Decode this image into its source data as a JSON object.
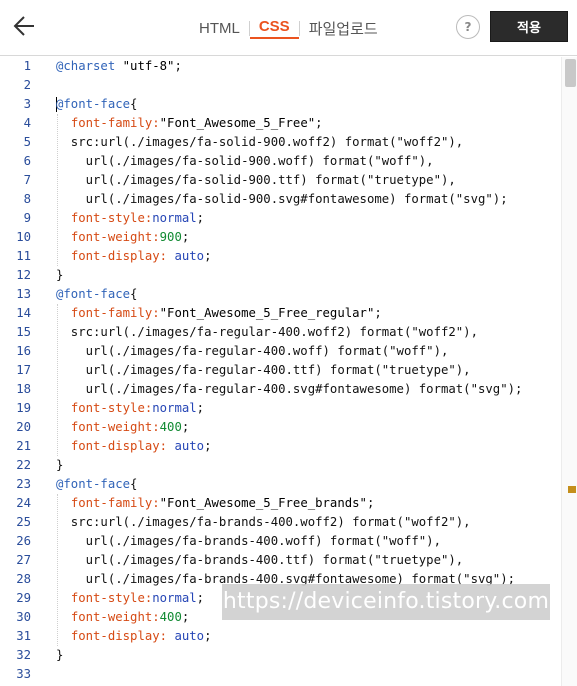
{
  "header": {
    "back_icon": "arrow-left-icon",
    "tabs": [
      {
        "label": "HTML",
        "active": false
      },
      {
        "label": "CSS",
        "active": true
      },
      {
        "label": "파일업로드",
        "active": false
      }
    ],
    "help_label": "?",
    "apply_label": "적용",
    "accent_color": "#eb531f"
  },
  "editor": {
    "line_numbers": [
      "1",
      "2",
      "3",
      "4",
      "5",
      "6",
      "7",
      "8",
      "9",
      "10",
      "11",
      "12",
      "13",
      "14",
      "15",
      "16",
      "17",
      "18",
      "19",
      "20",
      "21",
      "22",
      "23",
      "24",
      "25",
      "26",
      "27",
      "28",
      "29",
      "30",
      "31",
      "32",
      "33"
    ],
    "lines": [
      [
        {
          "t": "@charset ",
          "c": "at"
        },
        {
          "t": "\"utf-8\"",
          "c": "str"
        },
        {
          "t": ";",
          "c": "plain"
        }
      ],
      [],
      [
        {
          "t": "@font-face",
          "c": "at"
        },
        {
          "t": "{",
          "c": "plain"
        }
      ],
      [
        {
          "t": "  ",
          "c": "plain"
        },
        {
          "t": "font-family:",
          "c": "prop"
        },
        {
          "t": "\"Font_Awesome_5_Free\"",
          "c": "str"
        },
        {
          "t": ";",
          "c": "plain"
        }
      ],
      [
        {
          "t": "  src:url(./images/fa-solid-900.woff2) format(\"woff2\"),",
          "c": "plain"
        }
      ],
      [
        {
          "t": "    url(./images/fa-solid-900.woff) format(\"woff\"),",
          "c": "plain"
        }
      ],
      [
        {
          "t": "    url(./images/fa-solid-900.ttf) format(\"truetype\"),",
          "c": "plain"
        }
      ],
      [
        {
          "t": "    url(./images/fa-solid-900.svg#fontawesome) format(\"svg\");",
          "c": "plain"
        }
      ],
      [
        {
          "t": "  ",
          "c": "plain"
        },
        {
          "t": "font-style:",
          "c": "prop"
        },
        {
          "t": "normal",
          "c": "kw"
        },
        {
          "t": ";",
          "c": "plain"
        }
      ],
      [
        {
          "t": "  ",
          "c": "plain"
        },
        {
          "t": "font-weight:",
          "c": "prop"
        },
        {
          "t": "900",
          "c": "num"
        },
        {
          "t": ";",
          "c": "plain"
        }
      ],
      [
        {
          "t": "  ",
          "c": "plain"
        },
        {
          "t": "font-display: ",
          "c": "prop"
        },
        {
          "t": "auto",
          "c": "kw"
        },
        {
          "t": ";",
          "c": "plain"
        }
      ],
      [
        {
          "t": "}",
          "c": "plain"
        }
      ],
      [
        {
          "t": "@font-face",
          "c": "at"
        },
        {
          "t": "{",
          "c": "plain"
        }
      ],
      [
        {
          "t": "  ",
          "c": "plain"
        },
        {
          "t": "font-family:",
          "c": "prop"
        },
        {
          "t": "\"Font_Awesome_5_Free_regular\"",
          "c": "str"
        },
        {
          "t": ";",
          "c": "plain"
        }
      ],
      [
        {
          "t": "  src:url(./images/fa-regular-400.woff2) format(\"woff2\"),",
          "c": "plain"
        }
      ],
      [
        {
          "t": "    url(./images/fa-regular-400.woff) format(\"woff\"),",
          "c": "plain"
        }
      ],
      [
        {
          "t": "    url(./images/fa-regular-400.ttf) format(\"truetype\"),",
          "c": "plain"
        }
      ],
      [
        {
          "t": "    url(./images/fa-regular-400.svg#fontawesome) format(\"svg\");",
          "c": "plain"
        }
      ],
      [
        {
          "t": "  ",
          "c": "plain"
        },
        {
          "t": "font-style:",
          "c": "prop"
        },
        {
          "t": "normal",
          "c": "kw"
        },
        {
          "t": ";",
          "c": "plain"
        }
      ],
      [
        {
          "t": "  ",
          "c": "plain"
        },
        {
          "t": "font-weight:",
          "c": "prop"
        },
        {
          "t": "400",
          "c": "num"
        },
        {
          "t": ";",
          "c": "plain"
        }
      ],
      [
        {
          "t": "  ",
          "c": "plain"
        },
        {
          "t": "font-display: ",
          "c": "prop"
        },
        {
          "t": "auto",
          "c": "kw"
        },
        {
          "t": ";",
          "c": "plain"
        }
      ],
      [
        {
          "t": "}",
          "c": "plain"
        }
      ],
      [
        {
          "t": "@font-face",
          "c": "at"
        },
        {
          "t": "{",
          "c": "plain"
        }
      ],
      [
        {
          "t": "  ",
          "c": "plain"
        },
        {
          "t": "font-family:",
          "c": "prop"
        },
        {
          "t": "\"Font_Awesome_5_Free_brands\"",
          "c": "str"
        },
        {
          "t": ";",
          "c": "plain"
        }
      ],
      [
        {
          "t": "  src:url(./images/fa-brands-400.woff2) format(\"woff2\"),",
          "c": "plain"
        }
      ],
      [
        {
          "t": "    url(./images/fa-brands-400.woff) format(\"woff\"),",
          "c": "plain"
        }
      ],
      [
        {
          "t": "    url(./images/fa-brands-400.ttf) format(\"truetype\"),",
          "c": "plain"
        }
      ],
      [
        {
          "t": "    url(./images/fa-brands-400.svg#fontawesome) format(\"svg\");",
          "c": "plain"
        }
      ],
      [
        {
          "t": "  ",
          "c": "plain"
        },
        {
          "t": "font-style:",
          "c": "prop"
        },
        {
          "t": "normal",
          "c": "kw"
        },
        {
          "t": ";",
          "c": "plain"
        }
      ],
      [
        {
          "t": "  ",
          "c": "plain"
        },
        {
          "t": "font-weight:",
          "c": "prop"
        },
        {
          "t": "400",
          "c": "num"
        },
        {
          "t": ";",
          "c": "plain"
        }
      ],
      [
        {
          "t": "  ",
          "c": "plain"
        },
        {
          "t": "font-display: ",
          "c": "prop"
        },
        {
          "t": "auto",
          "c": "kw"
        },
        {
          "t": ";",
          "c": "plain"
        }
      ],
      [
        {
          "t": "}",
          "c": "plain"
        }
      ],
      []
    ],
    "cursor_line": 3
  },
  "watermark": {
    "text": "https://deviceinfo.tistory.com"
  }
}
